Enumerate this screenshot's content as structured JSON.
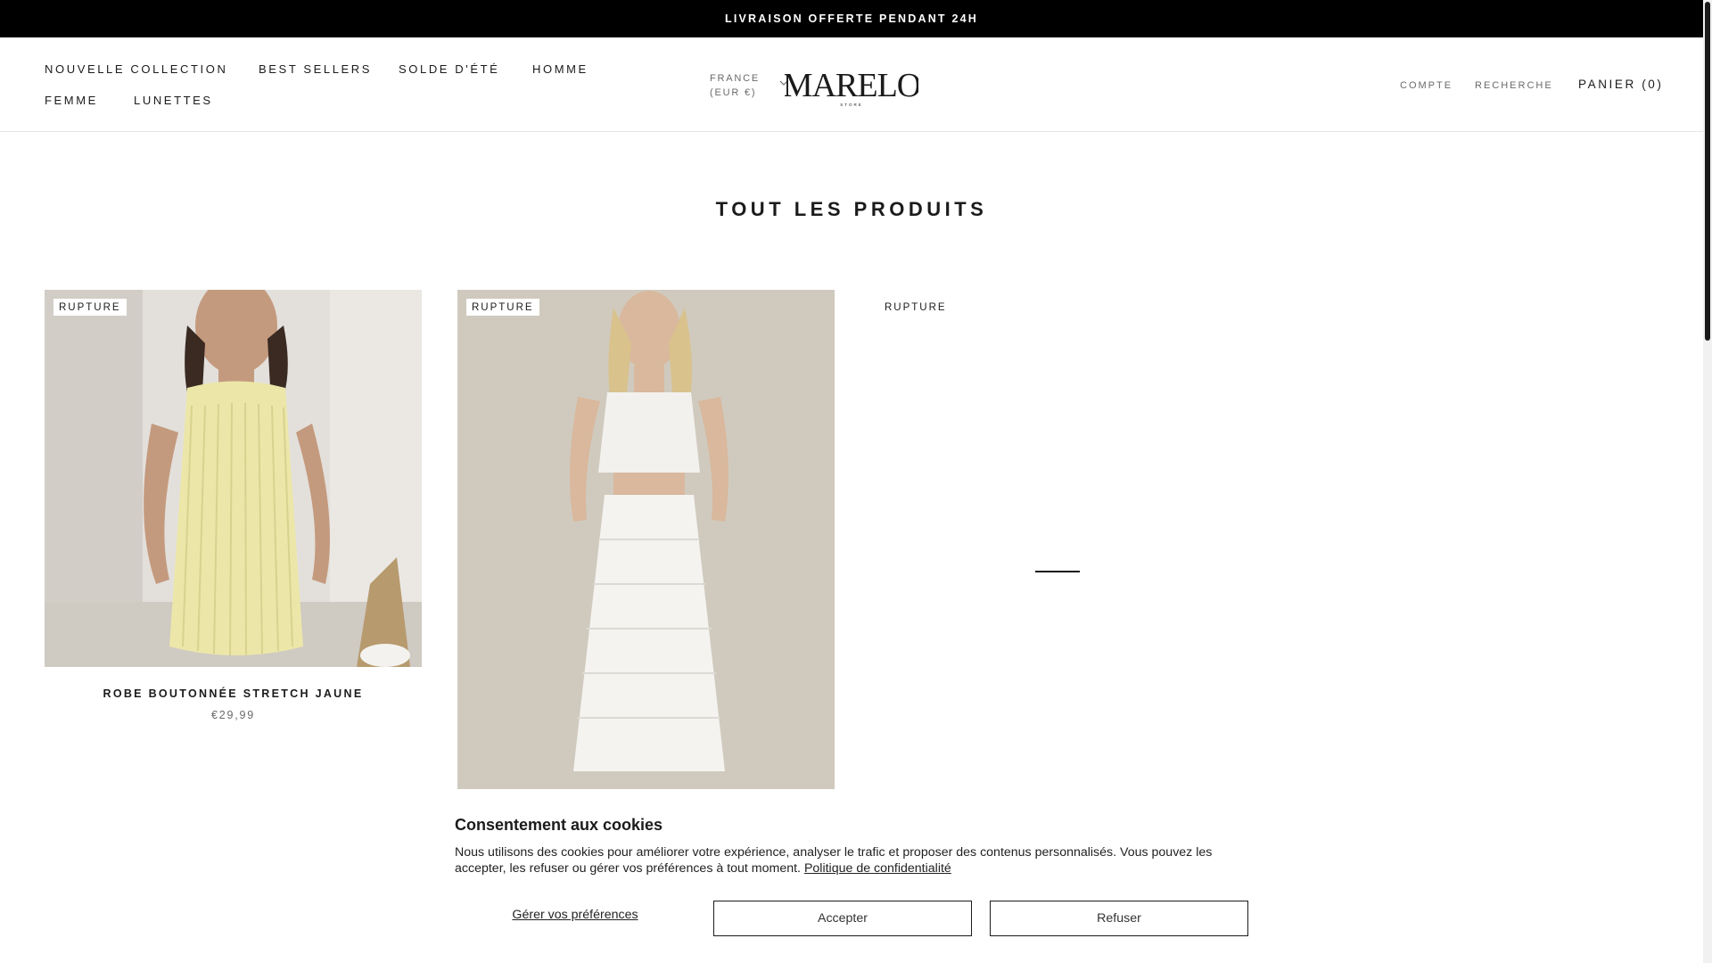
{
  "announcement": {
    "text": "LIVRAISON OFFERTE PENDANT 24H"
  },
  "nav": {
    "items": [
      {
        "label": "NOUVELLE COLLECTION"
      },
      {
        "label": "BEST SELLERS"
      },
      {
        "label": "SOLDE D'ÉTÉ"
      },
      {
        "label": "HOMME"
      },
      {
        "label": "FEMME"
      },
      {
        "label": "LUNETTES"
      }
    ]
  },
  "locale": {
    "country": "FRANCE",
    "currency": "(EUR €)"
  },
  "logo": {
    "text": "MARELO",
    "subtext": "STORE"
  },
  "utility": {
    "account": "COMPTE",
    "search": "RECHERCHE",
    "cart": "PANIER (0)"
  },
  "page": {
    "title": "TOUT LES PRODUITS"
  },
  "products": [
    {
      "badge": "RUPTURE",
      "title": "ROBE BOUTONNÉE STRETCH JAUNE",
      "price": "€29,99"
    },
    {
      "badge": "RUPTURE",
      "title": "",
      "price": ""
    },
    {
      "badge": "RUPTURE",
      "title": "",
      "price": ""
    }
  ],
  "cookie": {
    "title": "Consentement aux cookies",
    "text": "Nous utilisons des cookies pour améliorer votre expérience, analyser le trafic et proposer des contenus personnalisés. Vous pouvez les accepter, les refuser ou gérer vos préférences à tout moment.",
    "policy_link": "Politique de confidentialité",
    "manage_label": "Gérer vos préférences",
    "accept_label": "Accepter",
    "refuse_label": "Refuser"
  },
  "colors": {
    "text": "#1c1b1b",
    "muted": "#6a6a6a",
    "announcement_bg": "#000000",
    "border": "#e6e6e6"
  }
}
